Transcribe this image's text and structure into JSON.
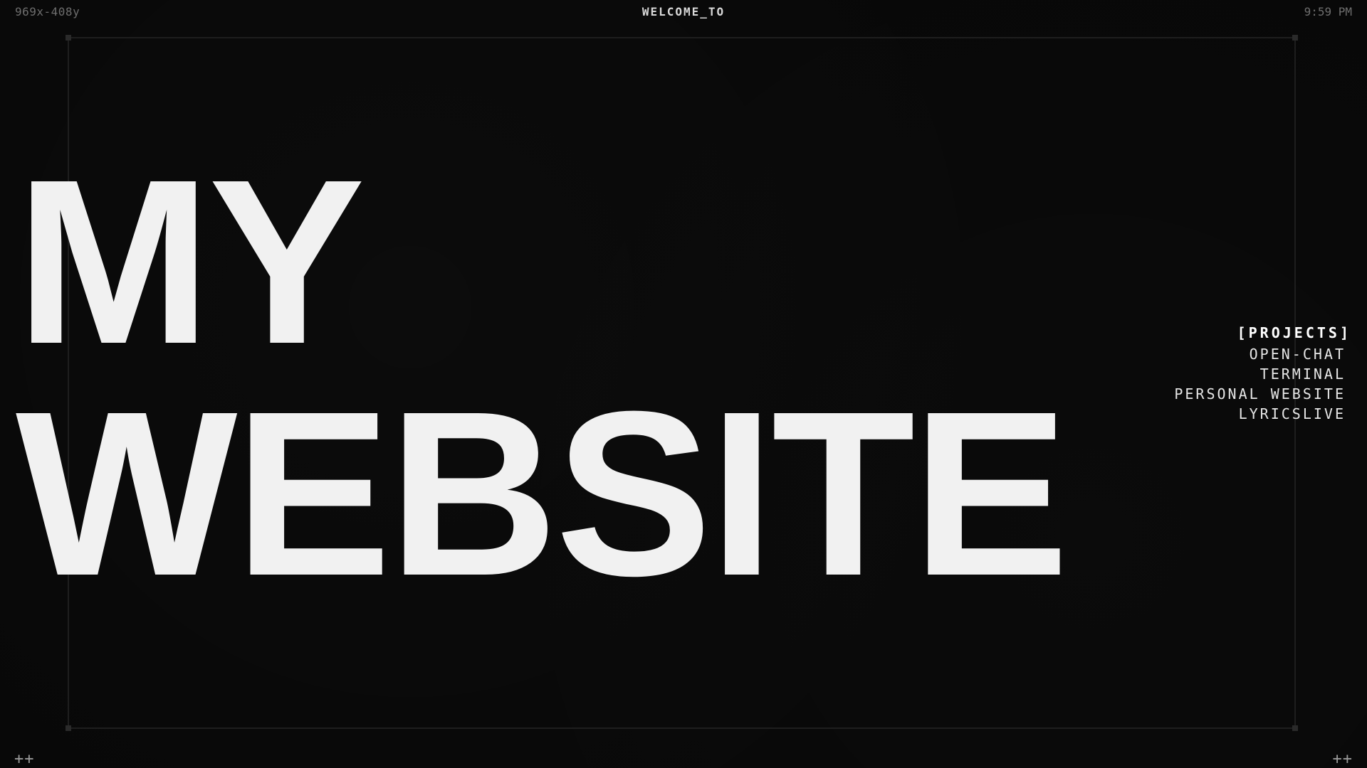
{
  "header": {
    "coordinates": "969x-408y",
    "title": "WELCOME_TO",
    "time": "9:59 PM"
  },
  "hero": {
    "line1": "MY",
    "line2": "WEBSITE"
  },
  "projects": {
    "heading": "[PROJECTS]",
    "items": [
      {
        "label": "OPEN-CHAT"
      },
      {
        "label": "TERMINAL"
      },
      {
        "label": "PERSONAL WEBSITE"
      },
      {
        "label": "LYRICSLIVE"
      }
    ]
  },
  "footer": {
    "left_marker": "++",
    "right_marker": "++"
  },
  "colors": {
    "background": "#080808",
    "text": "#f1f1f1",
    "muted": "#6e6e6e",
    "frame": "#1e1e1e"
  }
}
